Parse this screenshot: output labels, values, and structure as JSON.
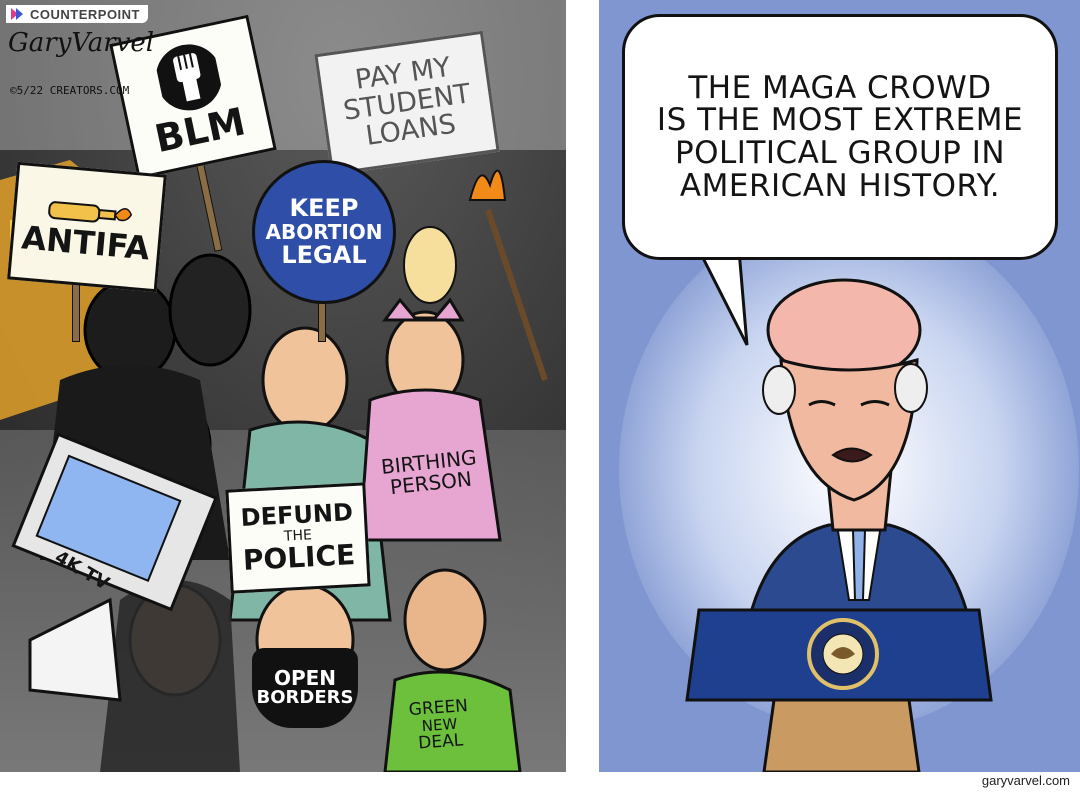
{
  "branding": {
    "name": "COUNTERPOINT"
  },
  "left_panel": {
    "signature": "GaryVarvel",
    "signature_date": "©5/22 CREATORS.COM",
    "signs": {
      "blm": "BLM",
      "antifa": "ANTIFA",
      "student_loans": [
        "PAY MY",
        "STUDENT",
        "LOANS"
      ],
      "abortion": [
        "KEEP",
        "ABORTION",
        "LEGAL"
      ],
      "defund": [
        "DEFUND",
        "THE",
        "POLICE"
      ],
      "tv": "4K TV",
      "birthing_shirt": [
        "BIRTHING",
        "PERSON"
      ],
      "mask": [
        "OPEN",
        "BORDERS"
      ],
      "green_shirt": [
        "GREEN",
        "NEW",
        "DEAL"
      ]
    }
  },
  "right_panel": {
    "speech": [
      "THE MAGA CROWD",
      "IS THE MOST EXTREME",
      "POLITICAL GROUP IN",
      "AMERICAN HISTORY."
    ],
    "seal_text": "SEAL OF THE PRESIDENT OF THE UNITED STATES"
  },
  "footer": {
    "credit": "garyvarvel.com"
  },
  "colors": {
    "smoke": "#3a3a3a",
    "fire": "#f0a22a",
    "right_background": "#7f96d0",
    "podium": "#1f3f8f",
    "sign_blue": "#2e4ea8",
    "pink": "#e7a6d2",
    "green": "#6cc03c"
  }
}
